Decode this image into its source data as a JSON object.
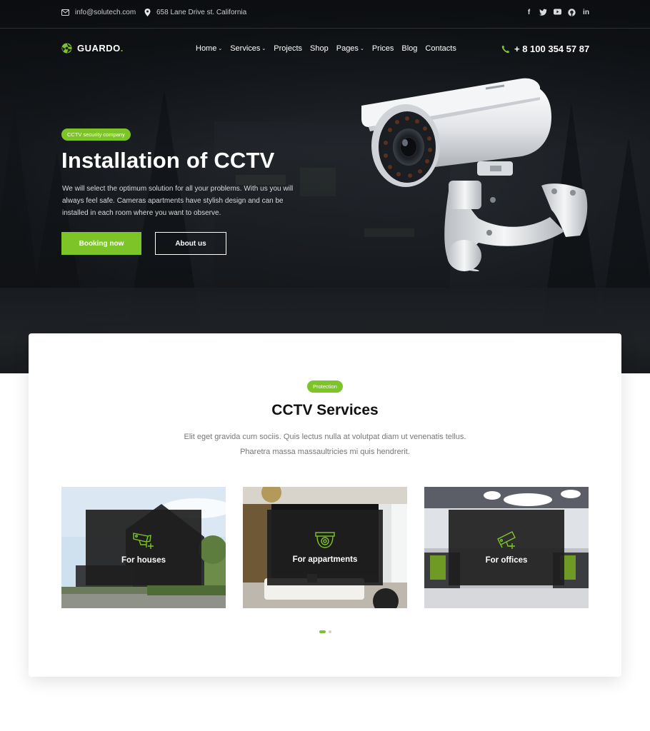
{
  "topbar": {
    "email": "info@solutech.com",
    "address": "658 Lane Drive st. California",
    "social_icons": [
      "facebook-icon",
      "twitter-icon",
      "youtube-icon",
      "github-icon",
      "linkedin-icon"
    ]
  },
  "header": {
    "logo_name": "GUARDO",
    "logo_dot": ".",
    "nav": [
      {
        "label": "Home",
        "dropdown": true
      },
      {
        "label": "Services",
        "dropdown": true
      },
      {
        "label": "Projects",
        "dropdown": false
      },
      {
        "label": "Shop",
        "dropdown": false
      },
      {
        "label": "Pages",
        "dropdown": true
      },
      {
        "label": "Prices",
        "dropdown": false
      },
      {
        "label": "Blog",
        "dropdown": false
      },
      {
        "label": "Contacts",
        "dropdown": false
      }
    ],
    "phone": "+ 8 100 354 57 87"
  },
  "hero": {
    "badge": "CCTV security company",
    "title": "Installation of CCTV",
    "description": "We will select the optimum solution for all your problems. With us you will always feel safe. Cameras apartments have stylish design and can be installed in each room where you want to observe.",
    "primary_button": "Booking now",
    "secondary_button": "About us"
  },
  "services": {
    "badge": "Protection",
    "title": "CCTV Services",
    "description_line1": "Elit eget gravida cum sociis. Quis lectus nulla at volutpat diam ut venenatis tellus.",
    "description_line2": "Pharetra massa massaultricies mi quis hendrerit.",
    "items": [
      {
        "label": "For houses",
        "icon": "cctv-camera-icon"
      },
      {
        "label": "For appartments",
        "icon": "dome-camera-icon"
      },
      {
        "label": "For offices",
        "icon": "cctv-camera-icon"
      }
    ],
    "slider_pages": 2,
    "slider_active": 1
  },
  "colors": {
    "accent": "#7dc428",
    "hero_dark": "#15181c"
  }
}
